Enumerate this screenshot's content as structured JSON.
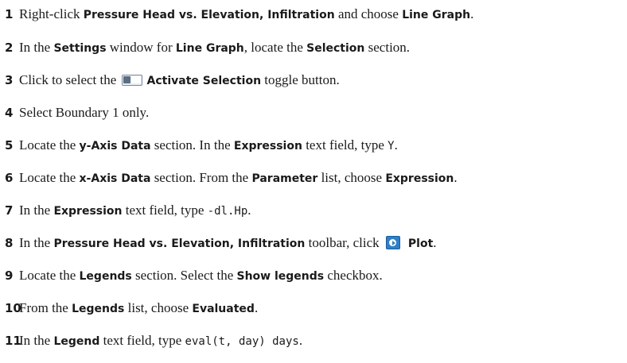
{
  "steps": [
    {
      "num": "1",
      "parts": [
        {
          "t": "Right-click "
        },
        {
          "t": "Pressure Head vs. Elevation, Infiltration",
          "s": "ui"
        },
        {
          "t": " and choose "
        },
        {
          "t": "Line Graph",
          "s": "ui"
        },
        {
          "t": "."
        }
      ]
    },
    {
      "num": "2",
      "parts": [
        {
          "t": "In the "
        },
        {
          "t": "Settings",
          "s": "ui"
        },
        {
          "t": " window for "
        },
        {
          "t": "Line Graph",
          "s": "ui"
        },
        {
          "t": ", locate the "
        },
        {
          "t": "Selection",
          "s": "ui"
        },
        {
          "t": " section."
        }
      ]
    },
    {
      "num": "3",
      "parts": [
        {
          "t": "Click to select the "
        },
        {
          "icon": "toggle-button-icon"
        },
        {
          "t": "Activate Selection",
          "s": "ui"
        },
        {
          "t": " toggle button."
        }
      ]
    },
    {
      "num": "4",
      "parts": [
        {
          "t": "Select Boundary 1 only."
        }
      ]
    },
    {
      "num": "5",
      "parts": [
        {
          "t": "Locate the "
        },
        {
          "t": "y-Axis Data",
          "s": "ui"
        },
        {
          "t": " section. In the "
        },
        {
          "t": "Expression",
          "s": "ui"
        },
        {
          "t": " text field, type "
        },
        {
          "t": "Y",
          "s": "code"
        },
        {
          "t": "."
        }
      ]
    },
    {
      "num": "6",
      "parts": [
        {
          "t": "Locate the "
        },
        {
          "t": "x-Axis Data",
          "s": "ui"
        },
        {
          "t": " section. From the "
        },
        {
          "t": "Parameter",
          "s": "ui"
        },
        {
          "t": " list, choose "
        },
        {
          "t": "Expression",
          "s": "ui"
        },
        {
          "t": "."
        }
      ]
    },
    {
      "num": "7",
      "parts": [
        {
          "t": "In the "
        },
        {
          "t": "Expression",
          "s": "ui"
        },
        {
          "t": " text field, type "
        },
        {
          "t": "-dl.Hp",
          "s": "code"
        },
        {
          "t": "."
        }
      ]
    },
    {
      "num": "8",
      "parts": [
        {
          "t": "In the "
        },
        {
          "t": "Pressure Head vs. Elevation, Infiltration",
          "s": "ui"
        },
        {
          "t": " toolbar, click "
        },
        {
          "icon": "plot-icon"
        },
        {
          "t": "Plot",
          "s": "ui"
        },
        {
          "t": "."
        }
      ]
    },
    {
      "num": "9",
      "parts": [
        {
          "t": "Locate the "
        },
        {
          "t": "Legends",
          "s": "ui"
        },
        {
          "t": " section. Select the "
        },
        {
          "t": "Show legends",
          "s": "ui"
        },
        {
          "t": " checkbox."
        }
      ]
    },
    {
      "num": "10",
      "parts": [
        {
          "t": "From the "
        },
        {
          "t": "Legends",
          "s": "ui"
        },
        {
          "t": " list, choose "
        },
        {
          "t": "Evaluated",
          "s": "ui"
        },
        {
          "t": "."
        }
      ]
    },
    {
      "num": "11",
      "parts": [
        {
          "t": "In the "
        },
        {
          "t": "Legend",
          "s": "ui"
        },
        {
          "t": " text field, type "
        },
        {
          "t": "eval(t, day) days",
          "s": "code"
        },
        {
          "t": "."
        }
      ]
    }
  ]
}
